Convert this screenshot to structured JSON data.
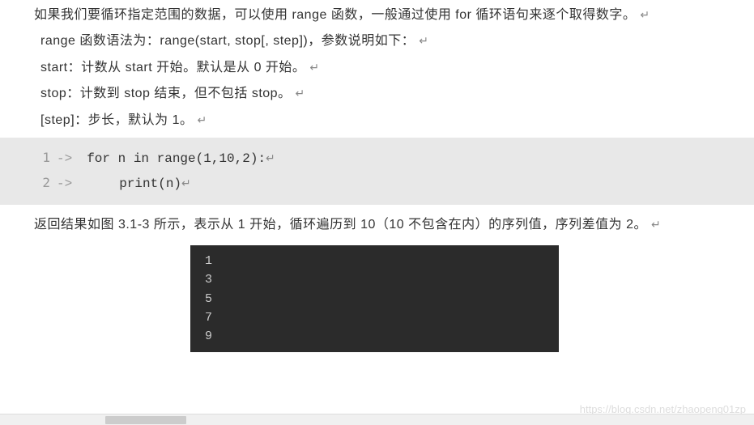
{
  "paragraphs": {
    "intro": "如果我们要循环指定范围的数据，可以使用 range 函数，一般通过使用 for 循环语句来逐个取得数字。",
    "syntax": "range 函数语法为：range(start, stop[, step])，参数说明如下：",
    "params": {
      "start": "start：计数从 start 开始。默认是从 0 开始。",
      "stop": "stop：计数到 stop 结束，但不包括 stop。",
      "step": "[step]：步长，默认为 1。"
    },
    "result": "返回结果如图 3.1-3 所示，表示从 1 开始，循环遍历到 10（10 不包含在内）的序列值，序列差值为 2。"
  },
  "return_marker": "↵",
  "code": {
    "lines": [
      {
        "num": "1",
        "arrow": "->",
        "text": "for n in range(1,10,2):"
      },
      {
        "num": "2",
        "arrow": "->",
        "text": "print(n)"
      }
    ]
  },
  "output": {
    "lines": [
      "1",
      "3",
      "5",
      "7",
      "9"
    ]
  },
  "watermark": "https://blog.csdn.net/zhaopeng01zp"
}
